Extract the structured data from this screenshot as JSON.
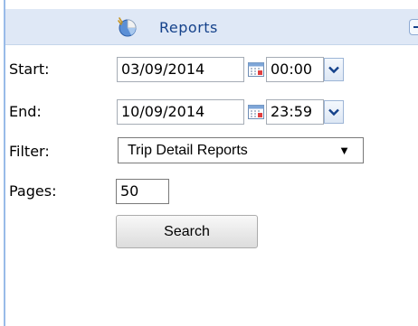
{
  "panel": {
    "title": "Reports",
    "icon": "reports-icon"
  },
  "form": {
    "start_label": "Start:",
    "start_date": "03/09/2014",
    "start_time": "00:00",
    "end_label": "End:",
    "end_date": "10/09/2014",
    "end_time": "23:59",
    "filter_label": "Filter:",
    "filter_value": "Trip Detail Reports",
    "filter_arrow": "▼",
    "pages_label": "Pages:",
    "pages_value": "50",
    "search_label": "Search"
  },
  "colors": {
    "header_bg": "#dfe8f6",
    "header_text": "#15428b",
    "panel_border": "#99bbe8"
  }
}
